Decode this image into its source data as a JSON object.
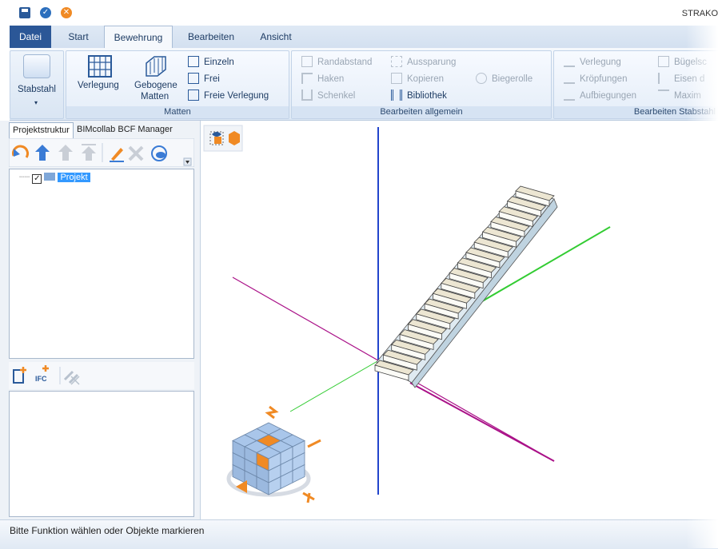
{
  "app": {
    "title": "STRAKO"
  },
  "ribbon_tabs": [
    {
      "label": "Datei"
    },
    {
      "label": "Start"
    },
    {
      "label": "Bewehrung"
    },
    {
      "label": "Bearbeiten"
    },
    {
      "label": "Ansicht"
    }
  ],
  "ribbon": {
    "stabstahl": {
      "label": "Stabstahl"
    },
    "matten": {
      "label": "Matten",
      "verlegung": "Verlegung",
      "gebogene_1": "Gebogene",
      "gebogene_2": "Matten",
      "einzeln": "Einzeln",
      "frei": "Frei",
      "freie_verlegung": "Freie Verlegung"
    },
    "bearbeiten_allgemein": {
      "label": "Bearbeiten allgemein",
      "randabstand": "Randabstand",
      "haken": "Haken",
      "schenkel": "Schenkel",
      "aussparung": "Aussparung",
      "kopieren": "Kopieren",
      "bibliothek": "Bibliothek",
      "biegerolle": "Biegerolle"
    },
    "bearbeiten_stabstahl": {
      "label": "Bearbeiten Stabstahl",
      "verlegung": "Verlegung",
      "kroepfungen": "Kröpfungen",
      "aufbiegungen": "Aufbiegungen",
      "buegel": "Bügelsc",
      "eisen": "Eisen d",
      "maxim": "Maxim"
    }
  },
  "panel": {
    "tabs": [
      {
        "label": "Projektstruktur"
      },
      {
        "label": "BIMcollab BCF Manager"
      }
    ],
    "tree": {
      "root": "Projekt"
    },
    "ifc_label": "IFC"
  },
  "status": {
    "text": "Bitte Funktion wählen oder Objekte markieren"
  },
  "colors": {
    "accent": "#2b5797",
    "axis_blue": "#2244cc",
    "axis_green": "#33cc33",
    "axis_magenta": "#aa1188",
    "cube_blue": "#a9c6ea",
    "cube_orange": "#f08a24"
  }
}
